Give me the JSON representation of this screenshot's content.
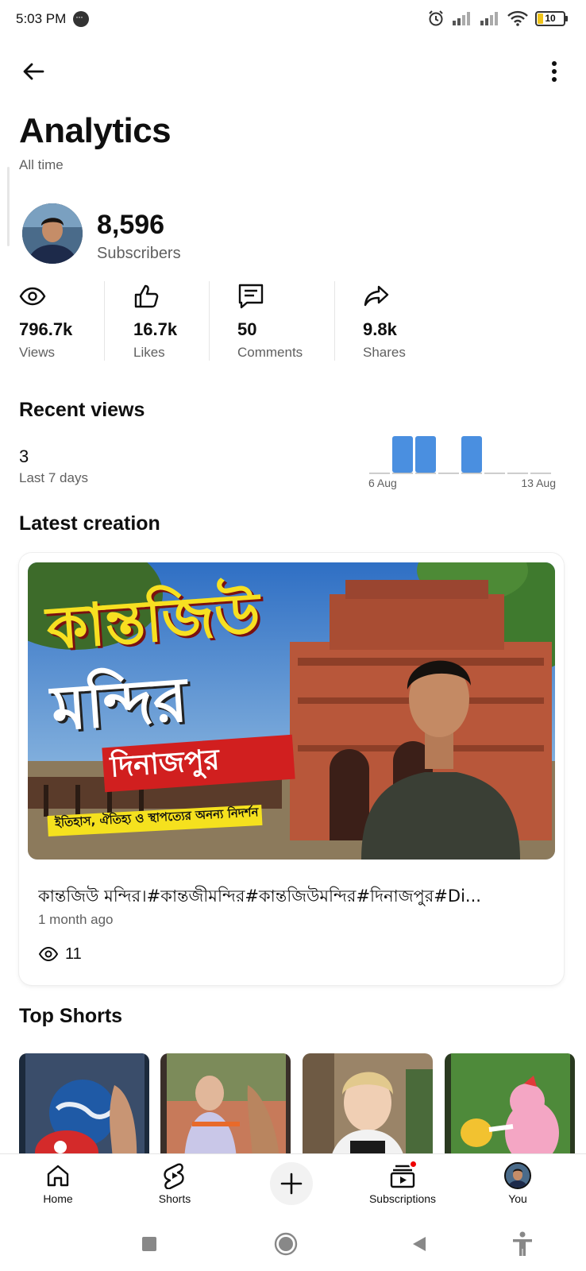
{
  "status_bar": {
    "time": "5:03 PM",
    "battery": "10"
  },
  "header": {
    "title": "Analytics",
    "range": "All time"
  },
  "channel": {
    "subscribers": "8,596",
    "subscribers_label": "Subscribers"
  },
  "stats": [
    {
      "value": "796.7k",
      "label": "Views",
      "icon": "eye-icon"
    },
    {
      "value": "16.7k",
      "label": "Likes",
      "icon": "thumbs-up-icon"
    },
    {
      "value": "50",
      "label": "Comments",
      "icon": "comment-icon"
    },
    {
      "value": "9.8k",
      "label": "Shares",
      "icon": "share-icon"
    }
  ],
  "recent_views": {
    "title": "Recent views",
    "count": "3",
    "period": "Last 7 days",
    "start_label": "6 Aug",
    "end_label": "13 Aug"
  },
  "chart_data": {
    "type": "bar",
    "categories": [
      "6 Aug",
      "7 Aug",
      "8 Aug",
      "9 Aug",
      "10 Aug",
      "11 Aug",
      "12 Aug",
      "13 Aug"
    ],
    "values": [
      0,
      1,
      1,
      0,
      1,
      0,
      0,
      0
    ],
    "xlabel": "",
    "ylabel": "",
    "ylim": [
      0,
      1
    ],
    "bar_color": "#4a8fe0",
    "empty_color": "#bdbdbd"
  },
  "latest": {
    "title": "Latest creation",
    "thumb_line1": "কান্তজিউ",
    "thumb_line2": "মন্দির",
    "thumb_line3": "দিনাজপুর",
    "thumb_line4": "ইতিহাস, ঐতিহ্য ও স্থাপত্যের অনন্য নিদর্শন",
    "video_title": "কান্তজিউ মন্দির।#কান্তজীমন্দির#কান্তজিউমন্দির#দিনাজপুর#Di...",
    "age": "1 month ago",
    "views": "11"
  },
  "top_shorts": {
    "title": "Top Shorts"
  },
  "bottom_nav": [
    {
      "label": "Home",
      "icon": "home-icon"
    },
    {
      "label": "Shorts",
      "icon": "shorts-icon"
    },
    {
      "label": "",
      "icon": "create-icon"
    },
    {
      "label": "Subscriptions",
      "icon": "subscriptions-icon"
    },
    {
      "label": "You",
      "icon": "avatar"
    }
  ],
  "colors": {
    "accent_bar": "#4a8fe0",
    "text_secondary": "#606060"
  }
}
